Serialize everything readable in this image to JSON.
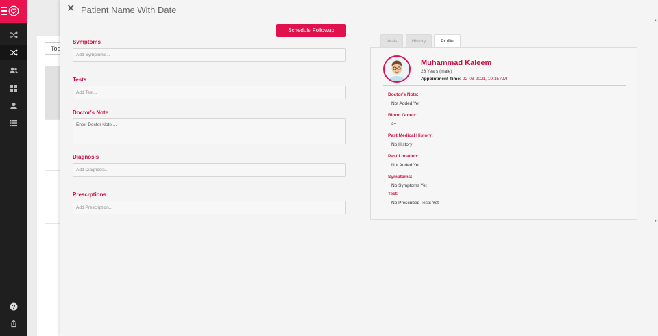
{
  "drawer": {
    "title": "Patient Name With Date",
    "close_icon": "close-icon",
    "schedule_button": "Schedule Followup"
  },
  "background": {
    "filter_chip": "Toda"
  },
  "form": {
    "symptoms": {
      "label": "Symptoms",
      "placeholder": "Add Symptoms..."
    },
    "tests": {
      "label": "Tests",
      "placeholder": "Add Test..."
    },
    "doctors_note": {
      "label": "Doctor's Note",
      "placeholder": "Enter Doctor Note ..."
    },
    "diagnosis": {
      "label": "Diagnosis",
      "placeholder": "Add Diagnosis..."
    },
    "prescriptions": {
      "label": "Prescrptions",
      "placeholder": "Add Prescription..."
    }
  },
  "tabs": [
    {
      "label": "Vitals",
      "active": false
    },
    {
      "label": "History",
      "active": false
    },
    {
      "label": "Profile",
      "active": true
    }
  ],
  "profile": {
    "name": "Muhammad Kaleem",
    "age_gender": "23 Years (male)",
    "appointment_label": "Appointment Time:",
    "appointment_value": "22-03-2021, 10:15 AM",
    "details": [
      {
        "label": "Doctor's Note:",
        "value": "Not Added Yet"
      },
      {
        "label": "Blood Group:",
        "value": "a+"
      },
      {
        "label": "Past Medical History:",
        "value": "No History"
      },
      {
        "label": "Past Location:",
        "value": "Not Added Yet"
      },
      {
        "label": "Symptoms:",
        "value": "No Symptoms Yet"
      },
      {
        "label": "Test:",
        "value": "No Prescribed Tests Yet"
      }
    ]
  },
  "sidebar": {
    "icons": [
      "menu-icon",
      "heart-logo-icon",
      "shuffle-icon",
      "shuffle-icon",
      "users-icon",
      "dashboard-icon",
      "user-icon",
      "list-icon",
      "help-icon",
      "logout-icon"
    ],
    "active_index": 1
  },
  "colors": {
    "accent": "#e0114c",
    "label": "#c8103f",
    "rail": "#1f1f1f"
  }
}
